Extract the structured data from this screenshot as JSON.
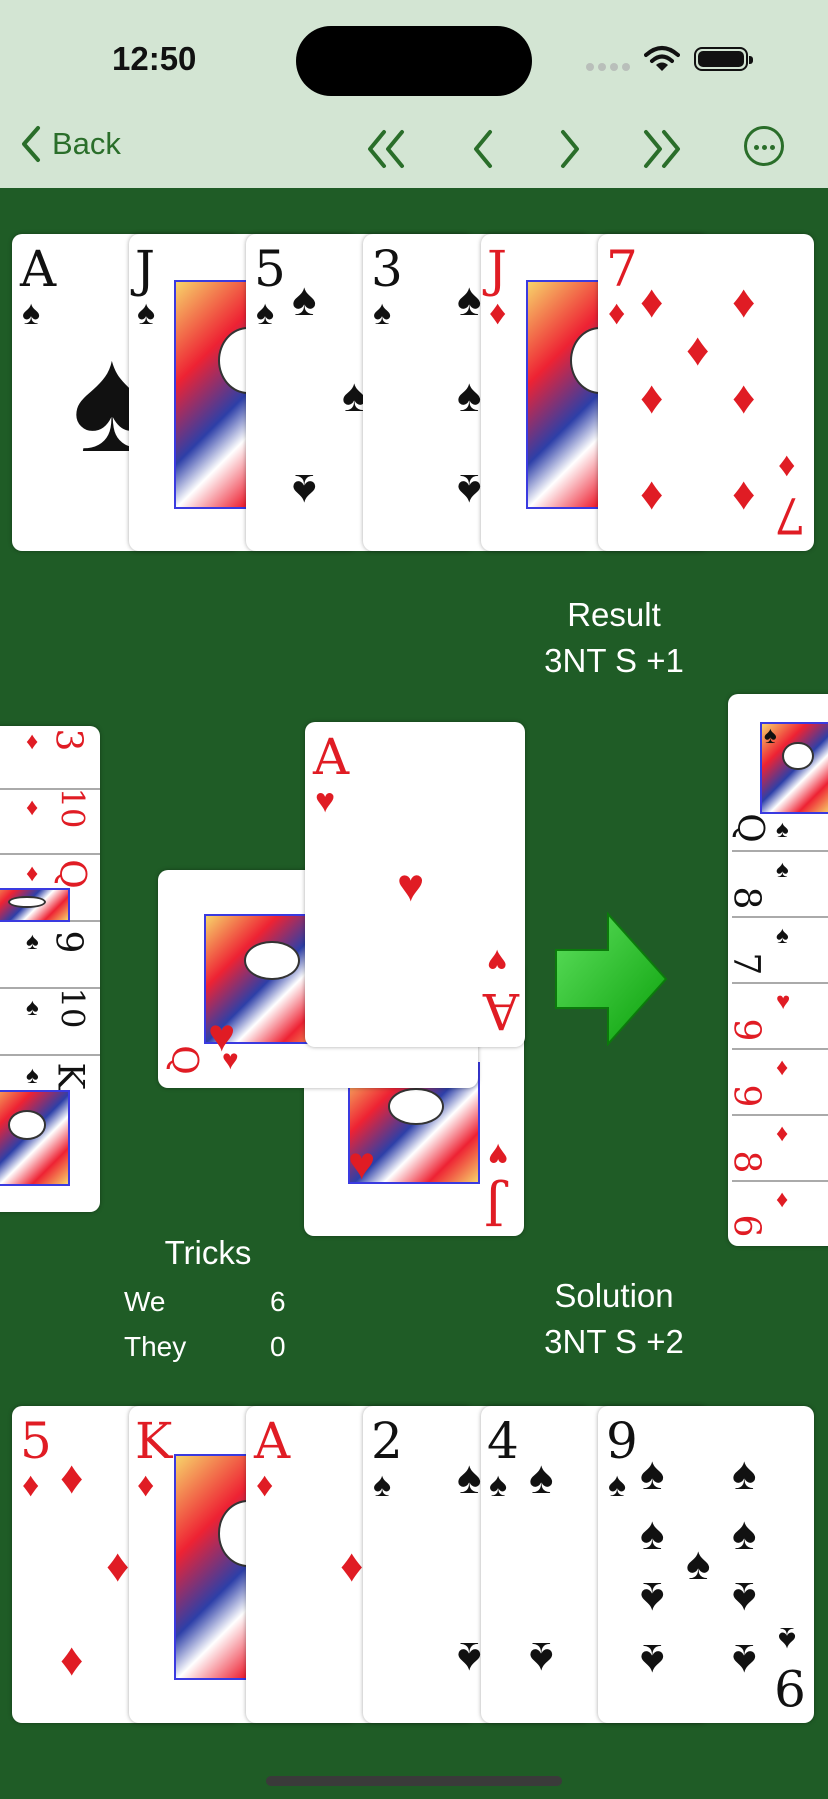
{
  "status": {
    "time": "12:50"
  },
  "nav": {
    "back_label": "Back"
  },
  "colors": {
    "felt": "#1f5c26",
    "bar": "#d3e5d3",
    "accent": "#2a6e2a",
    "red_suit": "#e01c24"
  },
  "north_hand": [
    {
      "rank": "A",
      "suit": "♠",
      "color": "black"
    },
    {
      "rank": "J",
      "suit": "♠",
      "color": "black"
    },
    {
      "rank": "5",
      "suit": "♠",
      "color": "black"
    },
    {
      "rank": "3",
      "suit": "♠",
      "color": "black"
    },
    {
      "rank": "J",
      "suit": "♦",
      "color": "red"
    },
    {
      "rank": "7",
      "suit": "♦",
      "color": "red"
    }
  ],
  "west_hand": [
    {
      "rank": "3",
      "suit": "♦"
    },
    {
      "rank": "10",
      "suit": "♦"
    },
    {
      "rank": "Q",
      "suit": "♦"
    },
    {
      "rank": "9",
      "suit": "♠"
    },
    {
      "rank": "10",
      "suit": "♠"
    },
    {
      "rank": "K",
      "suit": "♠"
    }
  ],
  "east_hand": [
    {
      "rank": "Q",
      "suit": "♠"
    },
    {
      "rank": "8",
      "suit": "♠"
    },
    {
      "rank": "7",
      "suit": "♠"
    },
    {
      "rank": "9",
      "suit": "♥"
    },
    {
      "rank": "9",
      "suit": "♦"
    },
    {
      "rank": "8",
      "suit": "♦"
    },
    {
      "rank": "6",
      "suit": "♦"
    }
  ],
  "trick": {
    "north": {
      "rank": "A",
      "suit": "♥"
    },
    "west": {
      "rank": "Q",
      "suit": "♥"
    },
    "south": {
      "rank": "J",
      "suit": "♥"
    }
  },
  "south_hand": [
    {
      "rank": "5",
      "suit": "♦",
      "color": "red"
    },
    {
      "rank": "K",
      "suit": "♦",
      "color": "red"
    },
    {
      "rank": "A",
      "suit": "♦",
      "color": "red"
    },
    {
      "rank": "2",
      "suit": "♠",
      "color": "black"
    },
    {
      "rank": "4",
      "suit": "♠",
      "color": "black"
    },
    {
      "rank": "9",
      "suit": "♠",
      "color": "black"
    }
  ],
  "result": {
    "title": "Result",
    "value": "3NT S +1"
  },
  "solution": {
    "title": "Solution",
    "value": "3NT S +2"
  },
  "tricks": {
    "title": "Tricks",
    "we_label": "We",
    "we_value": "6",
    "they_label": "They",
    "they_value": "0"
  },
  "icons": {
    "turn_indicator": "green-arrow-right-icon"
  }
}
